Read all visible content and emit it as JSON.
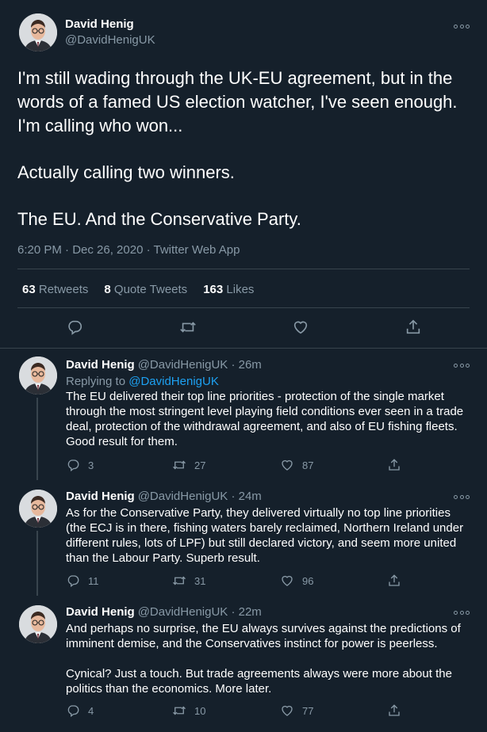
{
  "main_tweet": {
    "author_name": "David Henig",
    "author_handle": "@DavidHenigUK",
    "paragraphs": [
      "I'm still wading through the UK-EU agreement, but in the words of a famed US election watcher, I've seen enough. I'm calling who won...",
      "Actually calling two winners.",
      "The EU. And the Conservative Party."
    ],
    "meta": "6:20 PM · Dec 26, 2020 · Twitter Web App",
    "stats": {
      "retweets_count": "63",
      "retweets_label": "Retweets",
      "quotes_count": "8",
      "quotes_label": "Quote Tweets",
      "likes_count": "163",
      "likes_label": "Likes"
    }
  },
  "replies": [
    {
      "author_name": "David Henig",
      "handle_time": "@DavidHenigUK · 26m",
      "replying_prefix": "Replying to ",
      "replying_handle": "@DavidHenigUK",
      "lines": [
        "The EU delivered their top line priorities - protection of the single market",
        "through the most stringent level playing field conditions ever seen in a trade",
        "deal, protection of the withdrawal agreement, and also of EU fishing fleets.",
        "Good result for them."
      ],
      "replies": "3",
      "retweets": "27",
      "likes": "87"
    },
    {
      "author_name": "David Henig",
      "handle_time": "@DavidHenigUK · 24m",
      "lines": [
        "As for the Conservative Party, they delivered virtually no top line priorities",
        "(the ECJ is in there, fishing waters barely reclaimed, Northern Ireland under",
        "different rules, lots of LPF) but still declared victory, and seem more united",
        "than the Labour Party. Superb result."
      ],
      "replies": "11",
      "retweets": "31",
      "likes": "96"
    },
    {
      "author_name": "David Henig",
      "handle_time": "@DavidHenigUK · 22m",
      "lines": [
        "And perhaps no surprise, the EU always survives against the predictions of",
        "imminent demise, and the Conservatives instinct for power is peerless.",
        "",
        "Cynical? Just a touch. But trade agreements always were more about the",
        "politics than the economics. More later."
      ],
      "replies": "4",
      "retweets": "10",
      "likes": "77"
    }
  ],
  "icons": {
    "reply": "reply-icon",
    "retweet": "retweet-icon",
    "like": "like-icon",
    "share": "share-icon",
    "more": "more-icon"
  },
  "colors": {
    "background": "#15202b",
    "text": "#ffffff",
    "secondary": "#8899a6",
    "accent": "#1da1f2",
    "border": "#38444d"
  }
}
